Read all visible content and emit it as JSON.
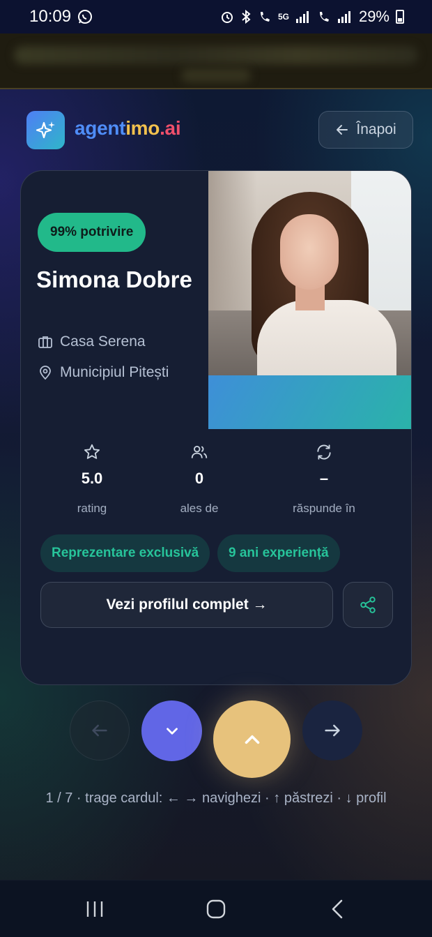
{
  "status_bar": {
    "time": "10:09",
    "battery": "29%",
    "network": "5G"
  },
  "header": {
    "brand_part1": "agent",
    "brand_part2": "imo",
    "brand_part3": ".ai",
    "back_label": "Înapoi"
  },
  "agent": {
    "match": "99% potrivire",
    "name": "Simona Dobre",
    "agency": "Casa Serena",
    "city": "Municipiul Pitești"
  },
  "stats": [
    {
      "icon": "star-icon",
      "value": "5.0",
      "label": "rating"
    },
    {
      "icon": "users-icon",
      "value": "0",
      "label": "ales de"
    },
    {
      "icon": "refresh-icon",
      "value": "–",
      "label": "răspunde în"
    }
  ],
  "tags": [
    "Reprezentare exclusivă",
    "9 ani experiență"
  ],
  "actions": {
    "profile_button": "Vezi profilul complet →"
  },
  "hint": "1 / 7 · trage cardul: ← → navighezi · ↑ păstrezi · ↓ profil",
  "colors": {
    "accent_green": "#22b98a",
    "accent_purple": "#6166e6",
    "accent_gold": "#e7c27c",
    "brand_blue": "#4f8df7",
    "brand_yellow": "#f2c14e",
    "brand_red": "#ef4f6b"
  }
}
